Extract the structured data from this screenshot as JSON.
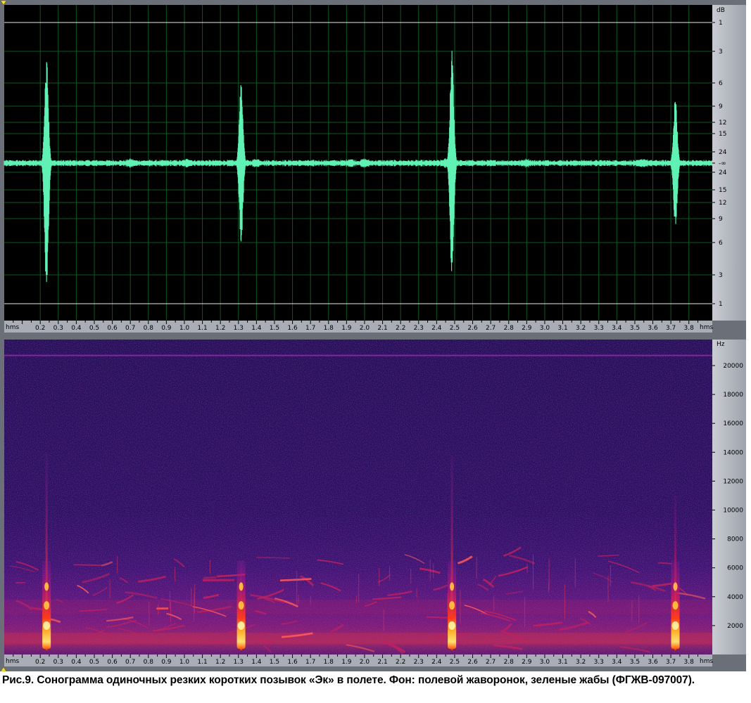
{
  "caption": "Рис.9. Сонограмма одиночных резких коротких позывок «Эк» в полете. Фон: полевой жаворонок, зеленые жабы (ФГЖВ-097007).",
  "colors": {
    "waveform": "#5ff2b4",
    "wave_background": "#000000",
    "grid": "#0a5a1e",
    "limit_line": "#ffffff",
    "scale_panel": "#a6abb3",
    "spectrogram_background": "#2a0f5c",
    "hot": "#ffd84a"
  },
  "chart_data": [
    {
      "type": "line",
      "title": "",
      "xlabel": "hms",
      "ylabel": "dB",
      "x_range": [
        0.0,
        3.93
      ],
      "x_ticks": [
        "0.2",
        "0.3",
        "0.4",
        "0.5",
        "0.6",
        "0.7",
        "0.8",
        "0.9",
        "1.0",
        "1.1",
        "1.2",
        "1.3",
        "1.4",
        "1.5",
        "1.6",
        "1.7",
        "1.8",
        "1.9",
        "2.0",
        "2.1",
        "2.2",
        "2.3",
        "2.4",
        "2.5",
        "2.6",
        "2.7",
        "2.8",
        "2.9",
        "3.0",
        "3.1",
        "3.2",
        "3.3",
        "3.4",
        "3.5",
        "3.6",
        "3.7",
        "3.8"
      ],
      "y_ticks_db": [
        "1",
        "3",
        "6",
        "9",
        "12",
        "15",
        "24",
        "-∞",
        "24",
        "15",
        "12",
        "9",
        "6",
        "3",
        "1"
      ],
      "y_unit": "dB",
      "grid": true,
      "noise_floor": 0.035,
      "calls": [
        {
          "t": 0.235,
          "pos": 0.75,
          "neg": 1.0
        },
        {
          "t": 1.315,
          "pos": 0.58,
          "neg": 0.57
        },
        {
          "t": 2.485,
          "pos": 0.81,
          "neg": 0.82
        },
        {
          "t": 3.725,
          "pos": 0.46,
          "neg": 0.47
        }
      ],
      "background_bursts": [
        0.7,
        1.02,
        1.4,
        1.92,
        2.0,
        2.45,
        2.9,
        3.55
      ]
    },
    {
      "type": "heatmap",
      "title": "",
      "xlabel": "hms",
      "ylabel": "Hz",
      "x_range": [
        0.0,
        3.93
      ],
      "y_range": [
        0,
        21800
      ],
      "x_ticks": [
        "0.2",
        "0.3",
        "0.4",
        "0.5",
        "0.6",
        "0.7",
        "0.8",
        "0.9",
        "1.0",
        "1.1",
        "1.2",
        "1.3",
        "1.4",
        "1.5",
        "1.6",
        "1.7",
        "1.8",
        "1.9",
        "2.0",
        "2.1",
        "2.2",
        "2.3",
        "2.4",
        "2.5",
        "2.6",
        "2.7",
        "2.8",
        "2.9",
        "3.0",
        "3.1",
        "3.2",
        "3.3",
        "3.4",
        "3.5",
        "3.6",
        "3.7",
        "3.8"
      ],
      "y_ticks": [
        2000,
        4000,
        6000,
        8000,
        10000,
        12000,
        14000,
        16000,
        18000,
        20000
      ],
      "calls": [
        {
          "t": 0.235,
          "f_top": 14000
        },
        {
          "t": 1.315,
          "f_top": 6500
        },
        {
          "t": 2.485,
          "f_top": 13800
        },
        {
          "t": 3.725,
          "f_top": 11000
        }
      ],
      "constant_line_hz": 20700,
      "background_band_hz": [
        500,
        7000
      ]
    }
  ]
}
